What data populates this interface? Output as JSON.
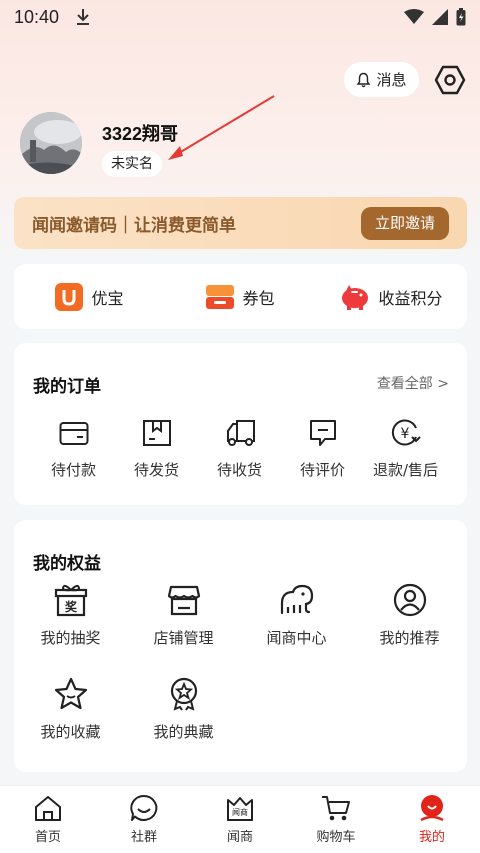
{
  "status_bar": {
    "time": "10:40"
  },
  "header": {
    "messages_label": "消息"
  },
  "profile": {
    "username": "3322翔哥",
    "realname_status": "未实名"
  },
  "invite": {
    "text": "闻闻邀请码｜让消费更简单",
    "button": "立即邀请"
  },
  "quick_links": [
    {
      "label": "优宝",
      "icon": "youbao-icon"
    },
    {
      "label": "券包",
      "icon": "coupon-icon"
    },
    {
      "label": "收益积分",
      "icon": "piggy-bank-icon"
    }
  ],
  "orders": {
    "title": "我的订单",
    "view_all": "查看全部 >",
    "items": [
      {
        "label": "待付款",
        "icon": "wallet-icon"
      },
      {
        "label": "待发货",
        "icon": "box-icon"
      },
      {
        "label": "待收货",
        "icon": "truck-icon"
      },
      {
        "label": "待评价",
        "icon": "comment-icon"
      },
      {
        "label": "退款/售后",
        "icon": "refund-icon"
      }
    ]
  },
  "benefits": {
    "title": "我的权益",
    "items": [
      {
        "label": "我的抽奖",
        "icon": "lottery-icon",
        "icon_text": "奖"
      },
      {
        "label": "店铺管理",
        "icon": "store-icon"
      },
      {
        "label": "闻商中心",
        "icon": "elephant-icon"
      },
      {
        "label": "我的推荐",
        "icon": "recommend-user-icon"
      },
      {
        "label": "我的收藏",
        "icon": "star-icon"
      },
      {
        "label": "我的典藏",
        "icon": "medal-icon"
      }
    ]
  },
  "tabbar": {
    "items": [
      {
        "label": "首页",
        "icon": "home-icon",
        "active": false
      },
      {
        "label": "社群",
        "icon": "community-icon",
        "active": false
      },
      {
        "label": "闻商",
        "icon": "wenshang-crown-icon",
        "icon_text": "闻商",
        "active": false
      },
      {
        "label": "购物车",
        "icon": "cart-icon",
        "active": false
      },
      {
        "label": "我的",
        "icon": "profile-icon",
        "active": true
      }
    ]
  },
  "colors": {
    "accent": "#e2231a",
    "invite_button": "#a4672d",
    "invite_text": "#8a5a2c",
    "annotation_arrow": "#e53935"
  }
}
